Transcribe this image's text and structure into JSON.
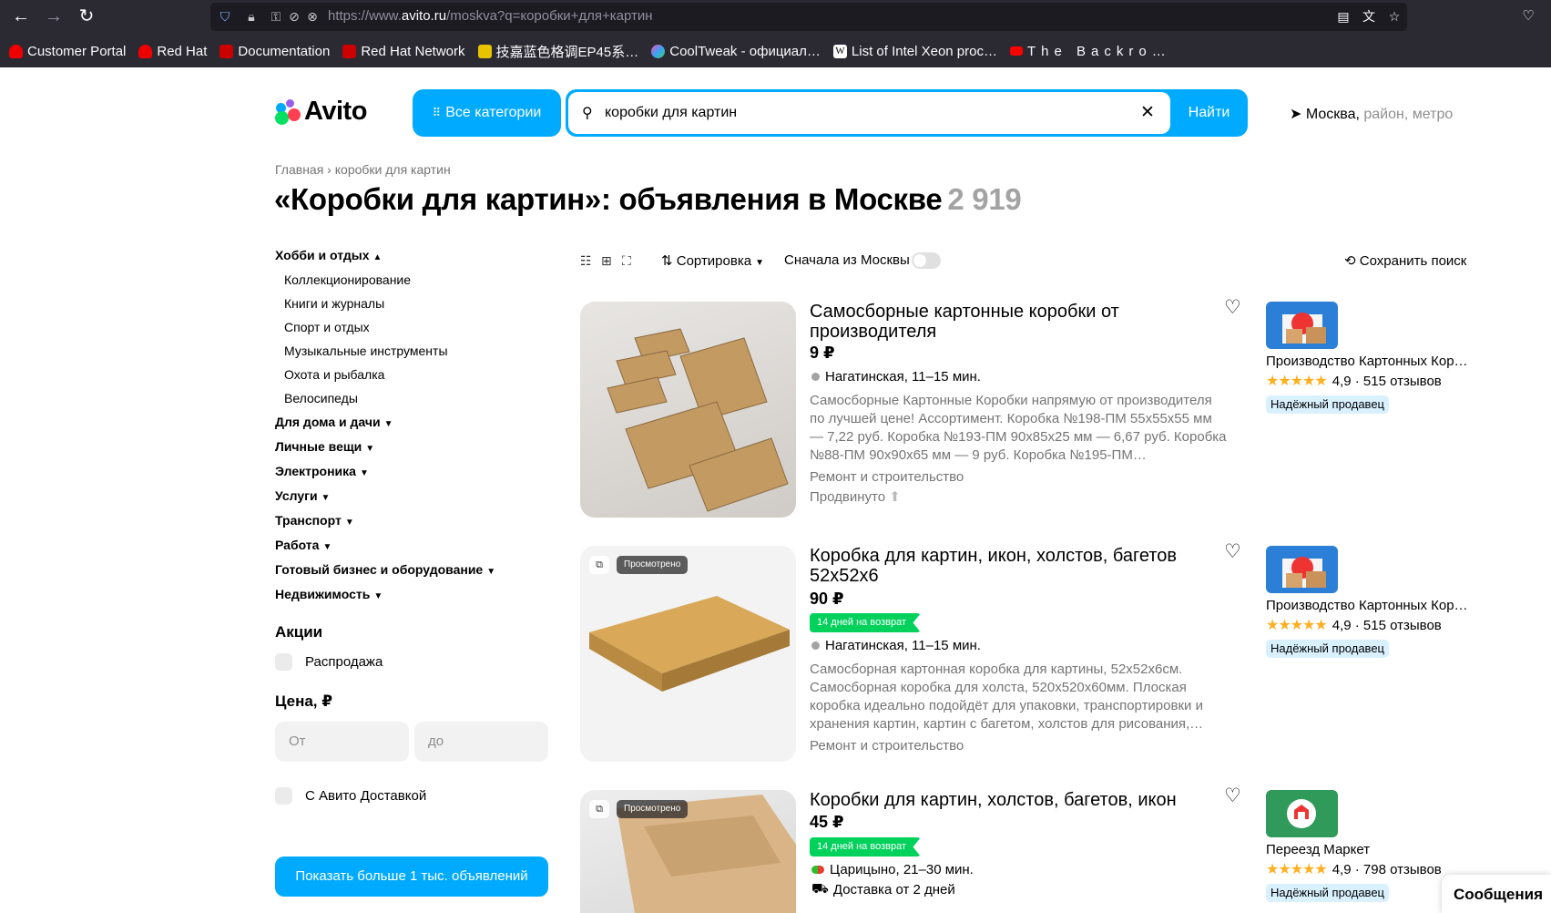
{
  "browser": {
    "url_prefix": "https://www.",
    "url_domain": "avito.ru",
    "url_path": "/moskva?q=коробки+для+картин",
    "bookmarks": [
      {
        "label": "Customer Portal",
        "color": "#ee0000"
      },
      {
        "label": "Red Hat",
        "color": "#ee0000"
      },
      {
        "label": "Documentation",
        "color": "#cc0000"
      },
      {
        "label": "Red Hat Network",
        "color": "#cc0000"
      },
      {
        "label": "技嘉蓝色格调EP45系…",
        "color": "#e8c300"
      },
      {
        "label": "CoolTweak - официал…",
        "color": "#3aa0ff"
      },
      {
        "label": "List of Intel Xeon proc…",
        "color": "#ffffff"
      },
      {
        "label": "The Backro…",
        "color": "#ff0000"
      }
    ]
  },
  "header": {
    "logo": "Avito",
    "all_categories": "Все категории",
    "search_query": "коробки для картин",
    "find": "Найти",
    "location_city": "Москва,",
    "location_hint": " район, метро"
  },
  "breadcrumb": {
    "home": "Главная",
    "sep": " › ",
    "current": "коробки для картин"
  },
  "title": {
    "text": "«Коробки для картин»: объявления в Москве",
    "count": "2 919"
  },
  "sidebar": {
    "expanded_category": "Хобби и отдых",
    "subcategories": [
      "Коллекционирование",
      "Книги и журналы",
      "Спорт и отдых",
      "Музыкальные инструменты",
      "Охота и рыбалка",
      "Велосипеды"
    ],
    "categories": [
      "Для дома и дачи",
      "Личные вещи",
      "Электроника",
      "Услуги",
      "Транспорт",
      "Работа",
      "Готовый бизнес и оборудование",
      "Недвижимость"
    ],
    "promo_title": "Акции",
    "sale": "Распродажа",
    "price_title": "Цена, ₽",
    "price_from": "От",
    "price_to": "до",
    "avito_delivery": "С Авито Доставкой",
    "show_more": "Показать больше 1 тыс. объявлений"
  },
  "toolbar": {
    "sort": "Сортировка",
    "moscow_first": "Сначала из Москвы",
    "save_search": "Сохранить поиск"
  },
  "listings": [
    {
      "title": "Самосборные картонные коробки от производителя",
      "price": "9 ₽",
      "location": "Нагатинская, 11–15 мин.",
      "description": "Самосборные Картонные Коробки напрямую от производителя по лучшей цене! Ассортимент. Коробка №198-ПМ 55х55х55 мм — 7,22 руб. Коробка №193-ПМ 90х85х25 мм — 6,67 руб. Коробка №88-ПМ 90х90х65 мм — 9 руб. Коробка №195-ПМ…",
      "category": "Ремонт и строительство",
      "promoted": "Продвинуто",
      "seller": "Производство Картонных Коробок",
      "rating": "4,9",
      "reviews": "515 отзывов",
      "trusted": "Надёжный продавец"
    },
    {
      "title": "Коробка для картин, икон, холстов, багетов 52х52х6",
      "price": "90 ₽",
      "seen": "Просмотрено",
      "return_badge": "14 дней на возврат",
      "location": "Нагатинская, 11–15 мин.",
      "description": "Самосборная картонная коробка для картины, 52х52х6см. Самосборная коробка для холста, 520х520х60мм. Плоская коробка идеально подойдёт для упаковки, транспортировки и хранения картин, картин с багетом, холстов для рисования,…",
      "category": "Ремонт и строительство",
      "seller": "Производство Картонных Коробок",
      "rating": "4,9",
      "reviews": "515 отзывов",
      "trusted": "Надёжный продавец"
    },
    {
      "title": "Коробки для картин, холстов, багетов, икон",
      "price": "45 ₽",
      "seen": "Просмотрено",
      "return_badge": "14 дней на возврат",
      "location": "Царицыно, 21–30 мин.",
      "delivery": "Доставка от 2 дней",
      "seller": "Переезд Маркет",
      "rating": "4,9",
      "reviews": "798 отзывов",
      "trusted": "Надёжный продавец"
    }
  ],
  "messages": "Сообщения",
  "colors": {
    "accent": "#00aaff",
    "return_badge": "#02d15c",
    "star": "#ffb021"
  }
}
